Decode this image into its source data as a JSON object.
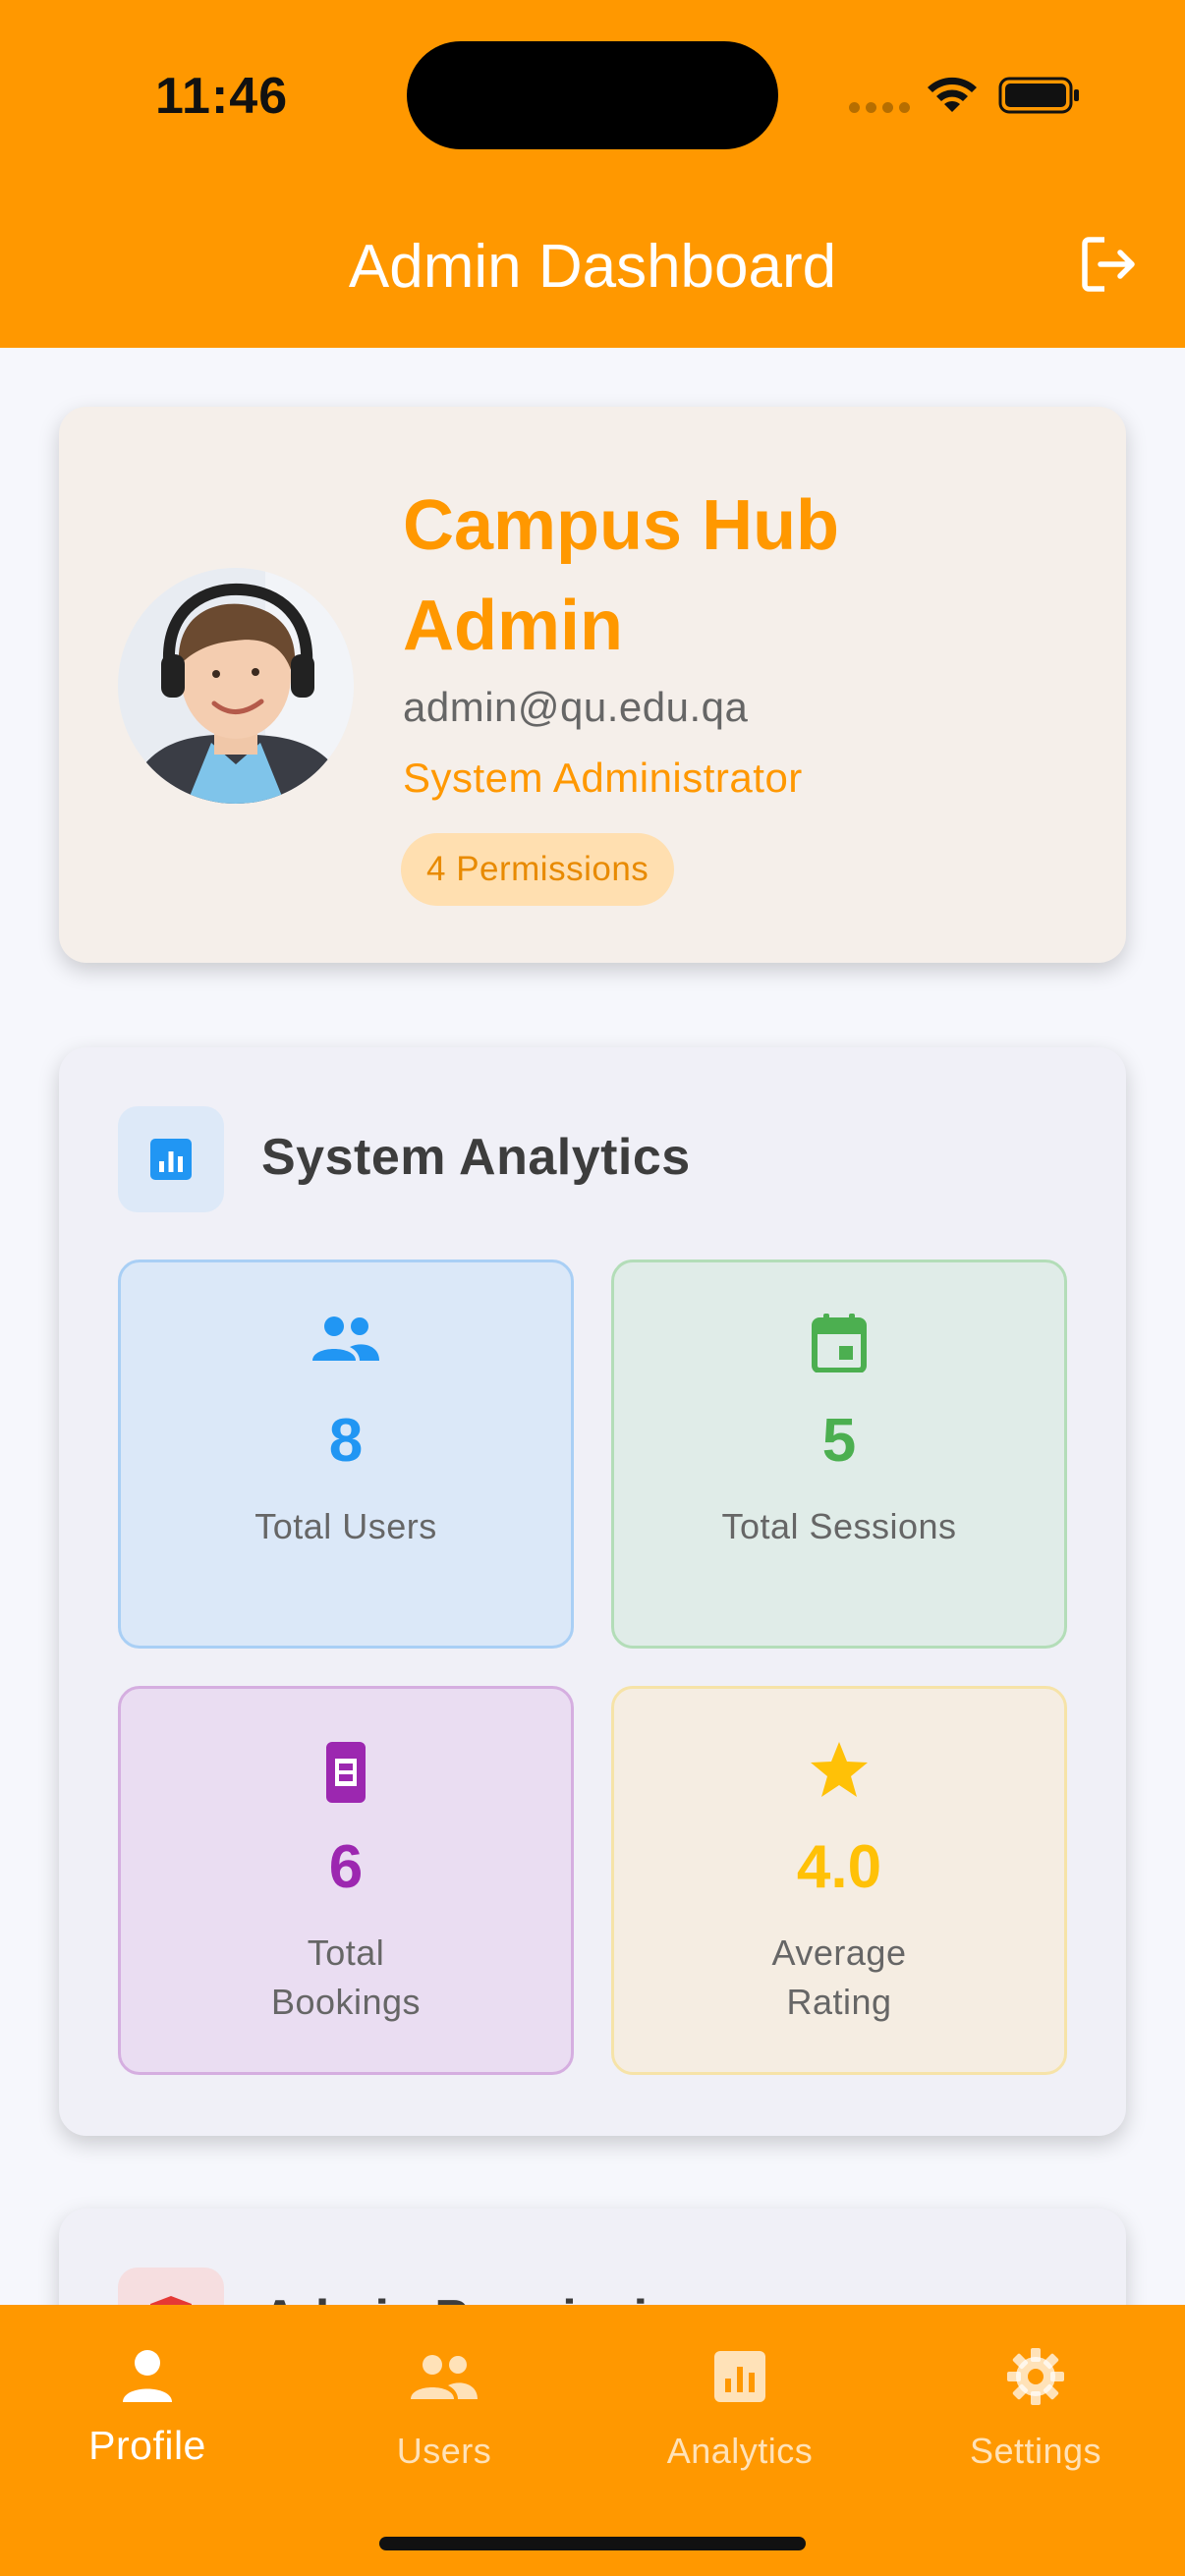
{
  "status_bar": {
    "time": "11:46"
  },
  "app_bar": {
    "title": "Admin Dashboard",
    "logout_icon": "logout-icon"
  },
  "profile": {
    "name": "Campus Hub Admin",
    "email": "admin@qu.edu.qa",
    "role": "System Administrator",
    "permissions_badge": "4 Permissions"
  },
  "analytics": {
    "title": "System Analytics",
    "icon": "analytics-icon",
    "stats": [
      {
        "value": "8",
        "label": "Total Users",
        "icon": "people-icon",
        "color": "#2196F3"
      },
      {
        "value": "5",
        "label": "Total Sessions",
        "icon": "calendar-icon",
        "color": "#4CAF50"
      },
      {
        "value": "6",
        "label": "Total Bookings",
        "icon": "booking-icon",
        "color": "#9C27B0"
      },
      {
        "value": "4.0",
        "label": "Average Rating",
        "icon": "star-icon",
        "color": "#FFC107"
      }
    ]
  },
  "permissions_section": {
    "title": "Admin Permissions",
    "icon": "shield-icon"
  },
  "bottom_nav": {
    "items": [
      {
        "label": "Profile",
        "icon": "person-icon",
        "active": true
      },
      {
        "label": "Users",
        "icon": "people-icon",
        "active": false
      },
      {
        "label": "Analytics",
        "icon": "analytics-icon",
        "active": false
      },
      {
        "label": "Settings",
        "icon": "gear-icon",
        "active": false
      }
    ]
  },
  "colors": {
    "primary": "#FF9800",
    "background": "#F6F7FC"
  }
}
